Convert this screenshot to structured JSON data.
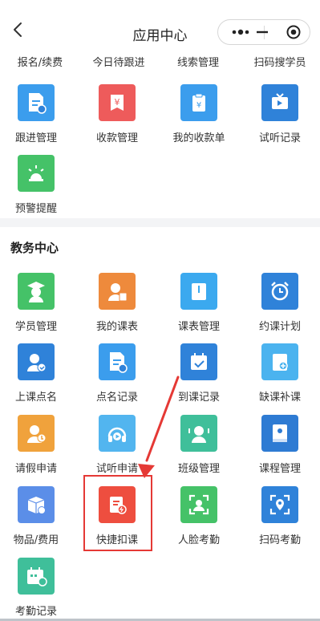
{
  "header": {
    "title": "应用中心"
  },
  "top_partial": [
    "报名/续费",
    "今日待跟进",
    "线索管理",
    "扫码搜学员"
  ],
  "top_rows": [
    {
      "label": "跟进管理",
      "icon": "follow-up-doc-icon",
      "color": "#3b9ded"
    },
    {
      "label": "收款管理",
      "icon": "payment-yuan-icon",
      "color": "#ee5b5b"
    },
    {
      "label": "我的收款单",
      "icon": "receipt-clipboard-icon",
      "color": "#3b9ded"
    },
    {
      "label": "试听记录",
      "icon": "trial-video-icon",
      "color": "#2f82d9"
    },
    {
      "label": "预警提醒",
      "icon": "alarm-light-icon",
      "color": "#45c268"
    }
  ],
  "edu": {
    "title": "教务中心",
    "items": [
      {
        "label": "学员管理",
        "icon": "student-graduate-icon",
        "color": "#45c268"
      },
      {
        "label": "我的课表",
        "icon": "my-schedule-icon",
        "color": "#ee8a3c"
      },
      {
        "label": "课表管理",
        "icon": "schedule-book-icon",
        "color": "#3ba9ef"
      },
      {
        "label": "约课计划",
        "icon": "alarm-clock-icon",
        "color": "#2f82d9"
      },
      {
        "label": "上课点名",
        "icon": "roll-call-icon",
        "color": "#2f82d9"
      },
      {
        "label": "点名记录",
        "icon": "roll-record-icon",
        "color": "#3b9ded"
      },
      {
        "label": "到课记录",
        "icon": "attendance-calendar-icon",
        "color": "#2f82d9"
      },
      {
        "label": "缺课补课",
        "icon": "makeup-book-icon",
        "color": "#4bb3ef"
      },
      {
        "label": "请假申请",
        "icon": "leave-request-icon",
        "color": "#f0a23c"
      },
      {
        "label": "试听申请",
        "icon": "trial-headphones-icon",
        "color": "#52b5ef"
      },
      {
        "label": "班级管理",
        "icon": "class-group-icon",
        "color": "#3fbf9a"
      },
      {
        "label": "课程管理",
        "icon": "course-book-icon",
        "color": "#2e7bd3"
      },
      {
        "label": "物品/费用",
        "icon": "goods-box-icon",
        "color": "#5b8ee8"
      },
      {
        "label": "快捷扣课",
        "icon": "quick-deduct-icon",
        "color": "#ee4e3f"
      },
      {
        "label": "人脸考勤",
        "icon": "face-scan-icon",
        "color": "#45c268"
      },
      {
        "label": "扫码考勤",
        "icon": "scan-location-icon",
        "color": "#2f82d9"
      },
      {
        "label": "考勤记录",
        "icon": "attendance-record-icon",
        "color": "#3fbf9a"
      }
    ]
  }
}
